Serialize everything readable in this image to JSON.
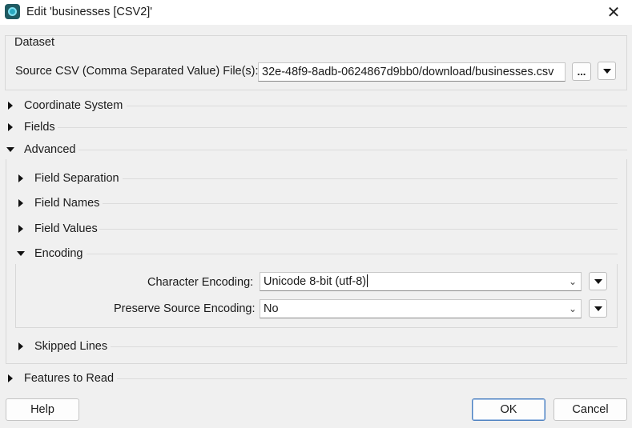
{
  "window": {
    "title": "Edit 'businesses [CSV2]'",
    "icon": "fme-app-icon"
  },
  "dataset": {
    "group_label": "Dataset",
    "source_label": "Source CSV (Comma Separated Value) File(s):",
    "source_value": "32e-48f9-8adb-0624867d9bb0/download/businesses.csv",
    "browse_label": "...",
    "menu_icon": "triangle-down-icon"
  },
  "sections": {
    "coordinate_system": "Coordinate System",
    "fields": "Fields",
    "advanced": "Advanced",
    "features_to_read": "Features to Read"
  },
  "advanced": {
    "field_separation": "Field Separation",
    "field_names": "Field Names",
    "field_values": "Field Values",
    "encoding": "Encoding",
    "skipped_lines": "Skipped Lines"
  },
  "encoding": {
    "char_label": "Character Encoding:",
    "char_value": "Unicode 8-bit (utf-8)",
    "preserve_label": "Preserve Source Encoding:",
    "preserve_value": "No"
  },
  "footer": {
    "help": "Help",
    "ok": "OK",
    "cancel": "Cancel"
  }
}
